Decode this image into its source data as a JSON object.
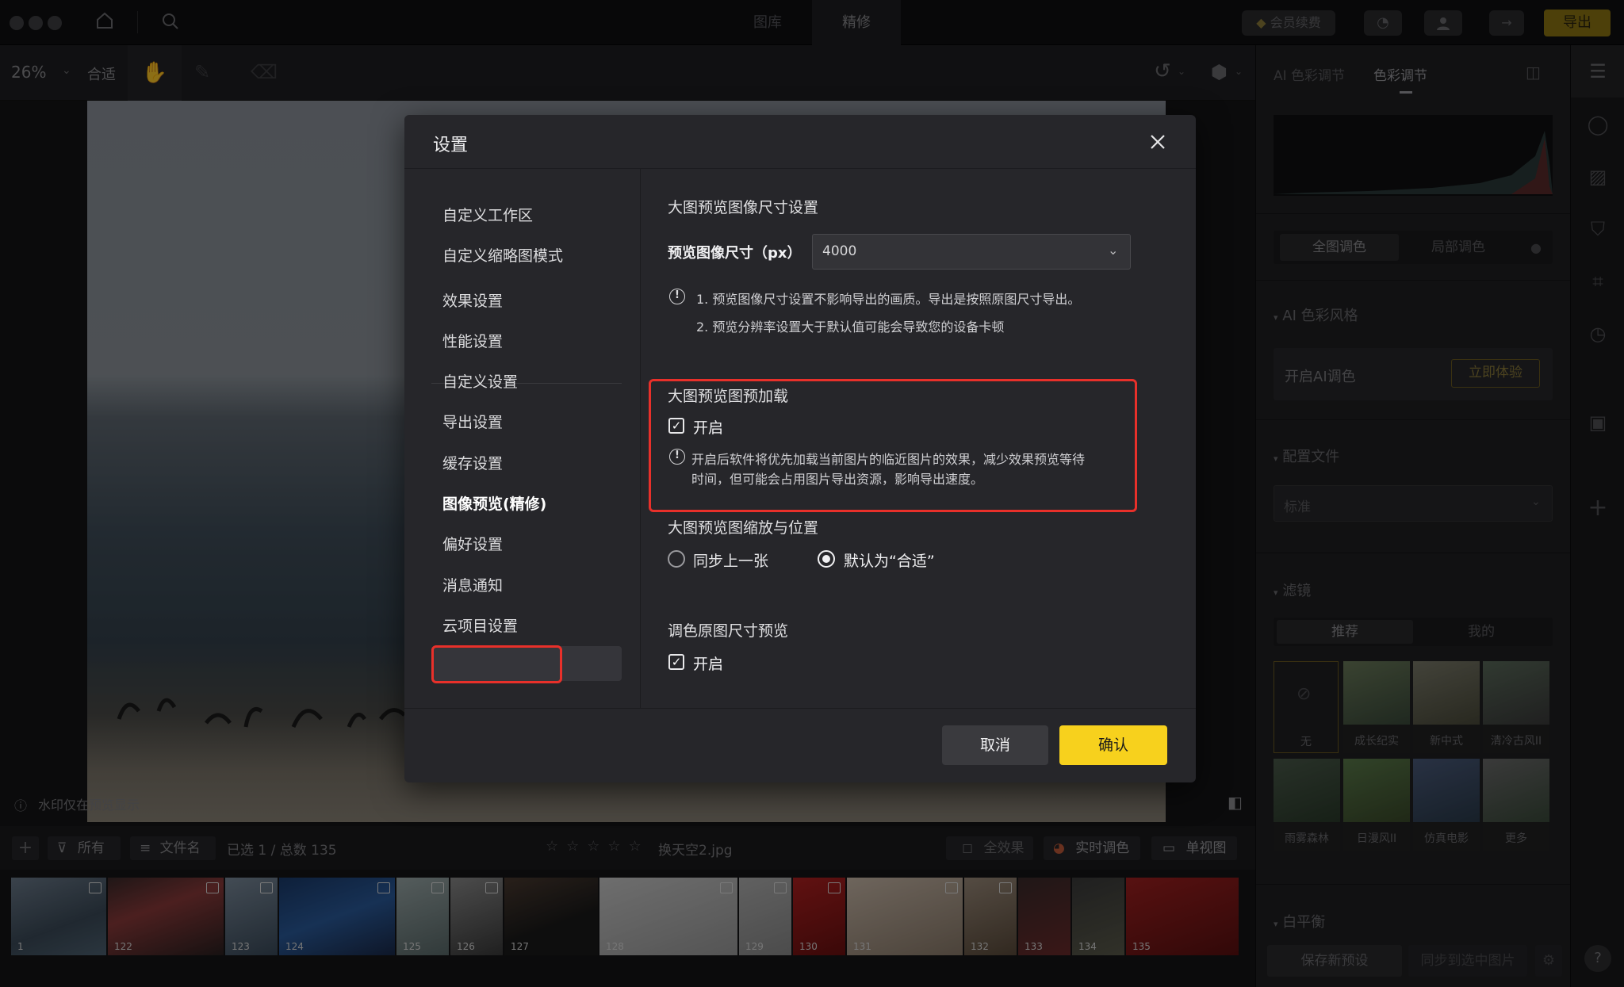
{
  "titlebar": {
    "tabs": [
      {
        "label": "图库"
      },
      {
        "label": "精修"
      }
    ],
    "member_label": "会员续费",
    "export_label": "导出"
  },
  "toolbar": {
    "zoom": "26%",
    "fit_label": "合适"
  },
  "canvas": {
    "watermark_note": "水印仅在预览显示"
  },
  "filmbar": {
    "filter_all": "所有",
    "sort_label": "文件名",
    "selection": "已选 1 / 总数 135",
    "filename": "换天空2.jpg",
    "all_effects": "全效果",
    "realtime_color": "实时调色",
    "single_view": "单视图",
    "rating_stars": 0
  },
  "filmstrip": {
    "numbers": [
      "1",
      "122",
      "123",
      "124",
      "125",
      "126",
      "127",
      "128",
      "129",
      "130",
      "131",
      "132",
      "133",
      "134",
      "135"
    ]
  },
  "right_panel": {
    "tabs": [
      {
        "label": "AI 色彩调节"
      },
      {
        "label": "色彩调节"
      }
    ],
    "subtabs": [
      {
        "label": "全图调色"
      },
      {
        "label": "局部调色"
      }
    ],
    "ai_style": {
      "title": "AI 色彩风格",
      "text": "开启AI调色",
      "button": "立即体验"
    },
    "profile": {
      "title": "配置文件",
      "value": "标准"
    },
    "filters": {
      "title": "滤镜",
      "tabs": [
        {
          "label": "推荐"
        },
        {
          "label": "我的"
        }
      ],
      "items": [
        {
          "label": "无"
        },
        {
          "label": "成长纪实"
        },
        {
          "label": "新中式"
        },
        {
          "label": "清冷古风II"
        },
        {
          "label": "雨雾森林"
        },
        {
          "label": "日漫风II"
        },
        {
          "label": "仿真电影"
        },
        {
          "label": "更多"
        }
      ]
    },
    "white_balance": {
      "title": "白平衡",
      "save_preset": "保存新预设",
      "sync": "同步到选中图片"
    }
  },
  "modal": {
    "title": "设置",
    "nav": [
      {
        "label": "自定义工作区"
      },
      {
        "label": "自定义缩略图模式"
      },
      {
        "label": "效果设置"
      },
      {
        "label": "性能设置"
      },
      {
        "label": "自定义设置"
      },
      {
        "label": "导出设置"
      },
      {
        "label": "缓存设置"
      },
      {
        "label": "图像预览(精修)"
      },
      {
        "label": "偏好设置"
      },
      {
        "label": "消息通知"
      },
      {
        "label": "云项目设置"
      }
    ],
    "size_section": {
      "title": "大图预览图像尺寸设置",
      "field_label": "预览图像尺寸（px）",
      "value": "4000",
      "note1": "1. 预览图像尺寸设置不影响导出的画质。导出是按照原图尺寸导出。",
      "note2": "2. 预览分辨率设置大于默认值可能会导致您的设备卡顿"
    },
    "preload_section": {
      "title": "大图预览图预加载",
      "checkbox_label": "开启",
      "checked": true,
      "note_line1": "开启后软件将优先加载当前图片的临近图片的效果，减少效果预览等待",
      "note_line2": "时间，但可能会占用图片导出资源，影响导出速度。"
    },
    "zoom_section": {
      "title": "大图预览图缩放与位置",
      "option1": "同步上一张",
      "option2": "默认为“合适”",
      "selected": "option2"
    },
    "original_section": {
      "title": "调色原图尺寸预览",
      "checkbox_label": "开启",
      "checked": true
    },
    "cancel_label": "取消",
    "confirm_label": "确认"
  },
  "colors": {
    "accent_yellow": "#f7d11d",
    "highlight_red": "#e8302a"
  }
}
